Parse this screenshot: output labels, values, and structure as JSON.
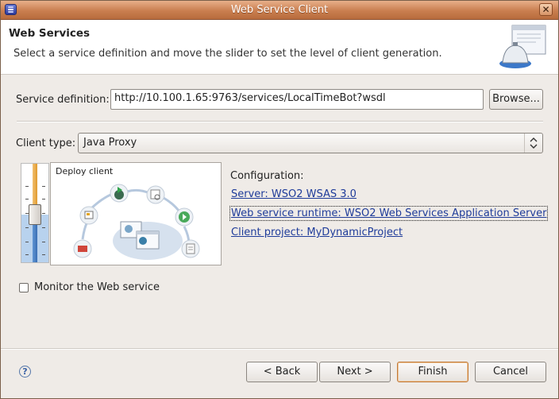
{
  "window": {
    "title": "Web Service Client",
    "close_glyph": "✕"
  },
  "header": {
    "title": "Web Services",
    "description": "Select a service definition and move the slider to set the level of client generation."
  },
  "service_definition": {
    "label": "Service definition:",
    "value": "http://10.100.1.65:9763/services/LocalTimeBot?wsdl",
    "browse_label": "Browse..."
  },
  "client_type": {
    "label": "Client type:",
    "selected": "Java Proxy"
  },
  "preview": {
    "title": "Deploy client"
  },
  "configuration": {
    "label": "Configuration:",
    "server": "Server: WSO2 WSAS 3.0",
    "runtime": "Web service runtime: WSO2 Web Services Application Server",
    "project": "Client project: MyDynamicProject"
  },
  "monitor": {
    "label": "Monitor the Web service",
    "checked": false
  },
  "buttons": {
    "back": "< Back",
    "next": "Next >",
    "finish": "Finish",
    "cancel": "Cancel",
    "help": "?"
  },
  "icons": {
    "app": "eclipse-window-icon",
    "wizard": "web-service-bell-icon",
    "help": "help-icon"
  }
}
